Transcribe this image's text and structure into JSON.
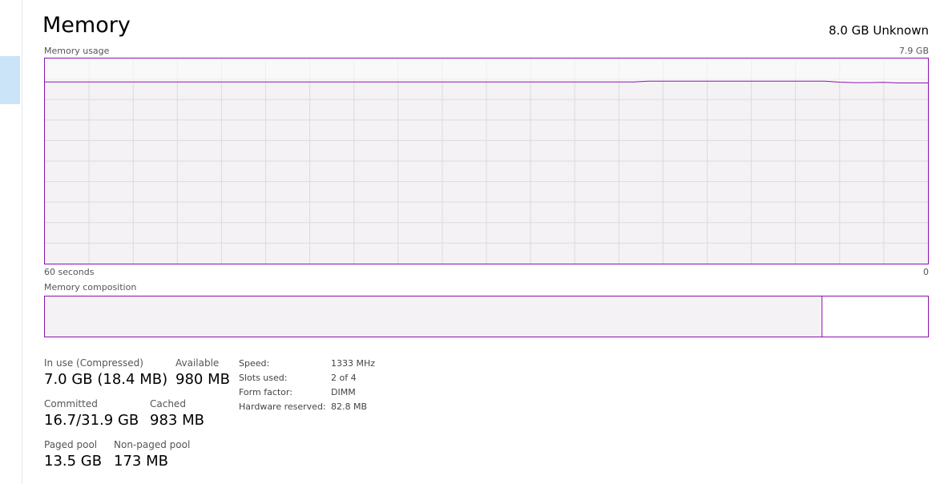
{
  "header": {
    "title": "Memory",
    "device": "8.0 GB Unknown"
  },
  "graph": {
    "label": "Memory usage",
    "max_label": "7.9 GB",
    "time_label": "60 seconds",
    "min_label": "0",
    "accent": "#8b12ae",
    "fill": "#f4f2f4"
  },
  "chart_data": {
    "type": "area",
    "title": "Memory usage",
    "ylabel": "",
    "xlabel": "60 seconds",
    "ylim": [
      0,
      7.9
    ],
    "x": [
      0,
      1,
      2,
      3,
      4,
      5,
      6,
      7,
      8,
      9,
      10,
      11,
      12,
      13,
      14,
      15,
      16,
      17,
      18,
      19,
      20,
      21,
      22,
      23,
      24,
      25,
      26,
      27,
      28,
      29,
      30,
      31,
      32,
      33,
      34,
      35,
      36,
      37,
      38,
      39,
      40,
      41,
      42,
      43,
      44,
      45,
      46,
      47,
      48,
      49,
      50,
      51,
      52,
      53,
      54,
      55,
      56,
      57,
      58,
      59,
      60
    ],
    "values": [
      7.0,
      7.0,
      7.0,
      7.0,
      7.0,
      7.0,
      7.0,
      7.0,
      7.0,
      7.0,
      7.0,
      7.0,
      7.0,
      7.0,
      7.0,
      7.0,
      7.0,
      7.0,
      7.0,
      7.0,
      7.0,
      7.0,
      7.0,
      7.0,
      7.0,
      7.0,
      7.0,
      7.0,
      7.0,
      7.0,
      7.0,
      7.0,
      7.0,
      7.0,
      7.0,
      7.0,
      7.0,
      7.0,
      7.0,
      7.0,
      7.0,
      7.03,
      7.03,
      7.03,
      7.03,
      7.03,
      7.03,
      7.03,
      7.03,
      7.03,
      7.03,
      7.03,
      7.03,
      7.03,
      6.99,
      6.97,
      6.97,
      6.98,
      6.96,
      6.96,
      6.96
    ]
  },
  "composition": {
    "label": "Memory composition",
    "in_use_fraction": 0.88
  },
  "stats": {
    "in_use": {
      "label": "In use (Compressed)",
      "value": "7.0 GB (18.4 MB)"
    },
    "available": {
      "label": "Available",
      "value": "980 MB"
    },
    "committed": {
      "label": "Committed",
      "value": "16.7/31.9 GB"
    },
    "cached": {
      "label": "Cached",
      "value": "983 MB"
    },
    "paged": {
      "label": "Paged pool",
      "value": "13.5 GB"
    },
    "nonpaged": {
      "label": "Non-paged pool",
      "value": "173 MB"
    }
  },
  "details": {
    "speed": {
      "label": "Speed:",
      "value": "1333 MHz"
    },
    "slots": {
      "label": "Slots used:",
      "value": "2 of 4"
    },
    "form": {
      "label": "Form factor:",
      "value": "DIMM"
    },
    "reserved": {
      "label": "Hardware reserved:",
      "value": "82.8 MB"
    }
  }
}
